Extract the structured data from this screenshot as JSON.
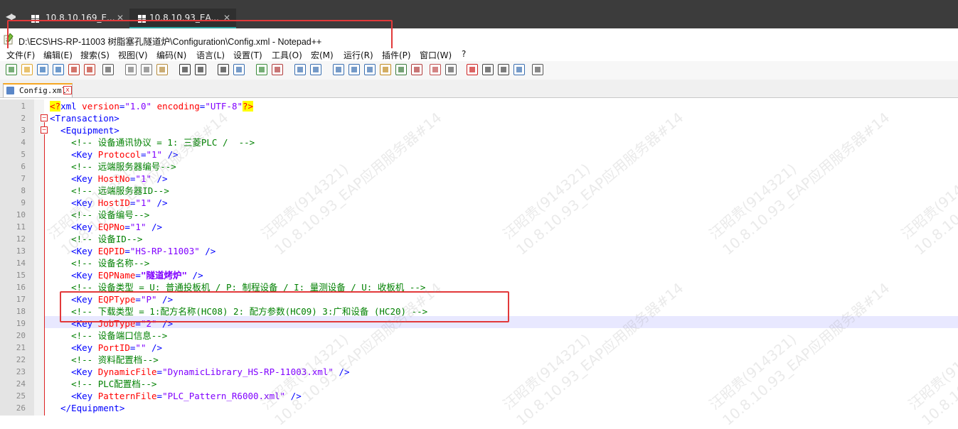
{
  "rdp_tabs": [
    {
      "label": "10.8.10.169_E...",
      "close": "✕"
    },
    {
      "label": "10.8.10.93_EA...",
      "close": "✕"
    }
  ],
  "window": {
    "title": "D:\\ECS\\HS-RP-11003 树脂塞孔隧道炉\\Configuration\\Config.xml - Notepad++"
  },
  "menu": [
    "文件(F)",
    "编辑(E)",
    "搜索(S)",
    "视图(V)",
    "编码(N)",
    "语言(L)",
    "设置(T)",
    "工具(O)",
    "宏(M)",
    "运行(R)",
    "插件(P)",
    "窗口(W)",
    "?"
  ],
  "toolbar_icons": [
    "new-file-icon",
    "open-file-icon",
    "save-icon",
    "save-all-icon",
    "close-icon",
    "close-all-icon",
    "print-icon",
    "cut-icon",
    "copy-icon",
    "paste-icon",
    "undo-icon",
    "redo-icon",
    "find-icon",
    "replace-icon",
    "zoom-in-icon",
    "zoom-out-icon",
    "sync-vertical-icon",
    "sync-horizontal-icon",
    "word-wrap-icon",
    "show-all-chars-icon",
    "indent-guide-icon",
    "udl-icon",
    "doc-map-icon",
    "function-list-icon",
    "folder-workspace-icon",
    "monitor-icon",
    "record-macro-icon",
    "stop-macro-icon",
    "play-macro-icon",
    "run-macro-multiple-icon",
    "save-macro-icon"
  ],
  "doc_tab": {
    "label": "Config.xml",
    "close": "x"
  },
  "line_numbers": [
    "1",
    "2",
    "3",
    "4",
    "5",
    "6",
    "7",
    "8",
    "9",
    "10",
    "11",
    "12",
    "13",
    "14",
    "15",
    "16",
    "17",
    "18",
    "19",
    "20",
    "21",
    "22",
    "23",
    "24",
    "25",
    "26"
  ],
  "code_lines": [
    [
      [
        "pi",
        "<?"
      ],
      [
        "tag",
        "xml "
      ],
      [
        "attr",
        "version"
      ],
      [
        "tag",
        "="
      ],
      [
        "val",
        "\"1.0\""
      ],
      [
        "tag",
        " "
      ],
      [
        "attr",
        "encoding"
      ],
      [
        "tag",
        "="
      ],
      [
        "val",
        "\"UTF-8\""
      ],
      [
        "pi",
        "?>"
      ]
    ],
    [
      [
        "tag",
        "<Transaction>"
      ]
    ],
    [
      [
        "tag",
        "  <Equipment>"
      ]
    ],
    [
      [
        "com",
        "    <!-- 设备通讯协议 = 1: 三菱PLC /  -->"
      ]
    ],
    [
      [
        "tag",
        "    <Key "
      ],
      [
        "attr",
        "Protocol"
      ],
      [
        "tag",
        "="
      ],
      [
        "val",
        "\"1\""
      ],
      [
        "tag",
        " />"
      ]
    ],
    [
      [
        "com",
        "    <!-- 远端服务器编号-->"
      ]
    ],
    [
      [
        "tag",
        "    <Key "
      ],
      [
        "attr",
        "HostNo"
      ],
      [
        "tag",
        "="
      ],
      [
        "val",
        "\"1\""
      ],
      [
        "tag",
        " />"
      ]
    ],
    [
      [
        "com",
        "    <!-- 远端服务器ID-->"
      ]
    ],
    [
      [
        "tag",
        "    <Key "
      ],
      [
        "attr",
        "HostID"
      ],
      [
        "tag",
        "="
      ],
      [
        "val",
        "\"1\""
      ],
      [
        "tag",
        " />"
      ]
    ],
    [
      [
        "com",
        "    <!-- 设备编号-->"
      ]
    ],
    [
      [
        "tag",
        "    <Key "
      ],
      [
        "attr",
        "EQPNo"
      ],
      [
        "tag",
        "="
      ],
      [
        "val",
        "\"1\""
      ],
      [
        "tag",
        " />"
      ]
    ],
    [
      [
        "com",
        "    <!-- 设备ID-->"
      ]
    ],
    [
      [
        "tag",
        "    <Key "
      ],
      [
        "attr",
        "EQPID"
      ],
      [
        "tag",
        "="
      ],
      [
        "val",
        "\"HS-RP-11003\""
      ],
      [
        "tag",
        " />"
      ]
    ],
    [
      [
        "com",
        "    <!-- 设备名称-->"
      ]
    ],
    [
      [
        "tag",
        "    <Key "
      ],
      [
        "attr",
        "EQPName"
      ],
      [
        "tag",
        "="
      ],
      [
        "valb",
        "\"隧道烤炉\""
      ],
      [
        "tag",
        " />"
      ]
    ],
    [
      [
        "com",
        "    <!-- 设备类型 = U: 普通投板机 / P: 制程设备 / I: 量测设备 / U: 收板机 -->"
      ]
    ],
    [
      [
        "tag",
        "    <Key "
      ],
      [
        "attr",
        "EQPType"
      ],
      [
        "tag",
        "="
      ],
      [
        "val",
        "\"P\""
      ],
      [
        "tag",
        " />"
      ]
    ],
    [
      [
        "com",
        "    <!-- 下载类型 = 1:配方名称(HC08) 2: 配方参数(HC09) 3:广和设备 (HC20) -->"
      ]
    ],
    [
      [
        "tag",
        "    <Key "
      ],
      [
        "attr",
        "JobType"
      ],
      [
        "tag",
        "="
      ],
      [
        "val",
        "\"2\""
      ],
      [
        "tag",
        " />"
      ]
    ],
    [
      [
        "com",
        "    <!-- 设备端口信息-->"
      ]
    ],
    [
      [
        "tag",
        "    <Key "
      ],
      [
        "attr",
        "PortID"
      ],
      [
        "tag",
        "="
      ],
      [
        "val",
        "\"\""
      ],
      [
        "tag",
        " />"
      ]
    ],
    [
      [
        "com",
        "    <!-- 资料配置档-->"
      ]
    ],
    [
      [
        "tag",
        "    <Key "
      ],
      [
        "attr",
        "DynamicFile"
      ],
      [
        "tag",
        "="
      ],
      [
        "val",
        "\"DynamicLibrary_HS-RP-11003.xml\""
      ],
      [
        "tag",
        " />"
      ]
    ],
    [
      [
        "com",
        "    <!-- PLC配置档-->"
      ]
    ],
    [
      [
        "tag",
        "    <Key "
      ],
      [
        "attr",
        "PatternFile"
      ],
      [
        "tag",
        "="
      ],
      [
        "val",
        "\"PLC_Pattern_R6000.xml\""
      ],
      [
        "tag",
        " />"
      ]
    ],
    [
      [
        "tag",
        "  </Equipment>"
      ]
    ]
  ],
  "watermark": {
    "line1": "汪昭贵(914321)",
    "line2": "10.8.10.93_EAP应用服务器#14"
  }
}
